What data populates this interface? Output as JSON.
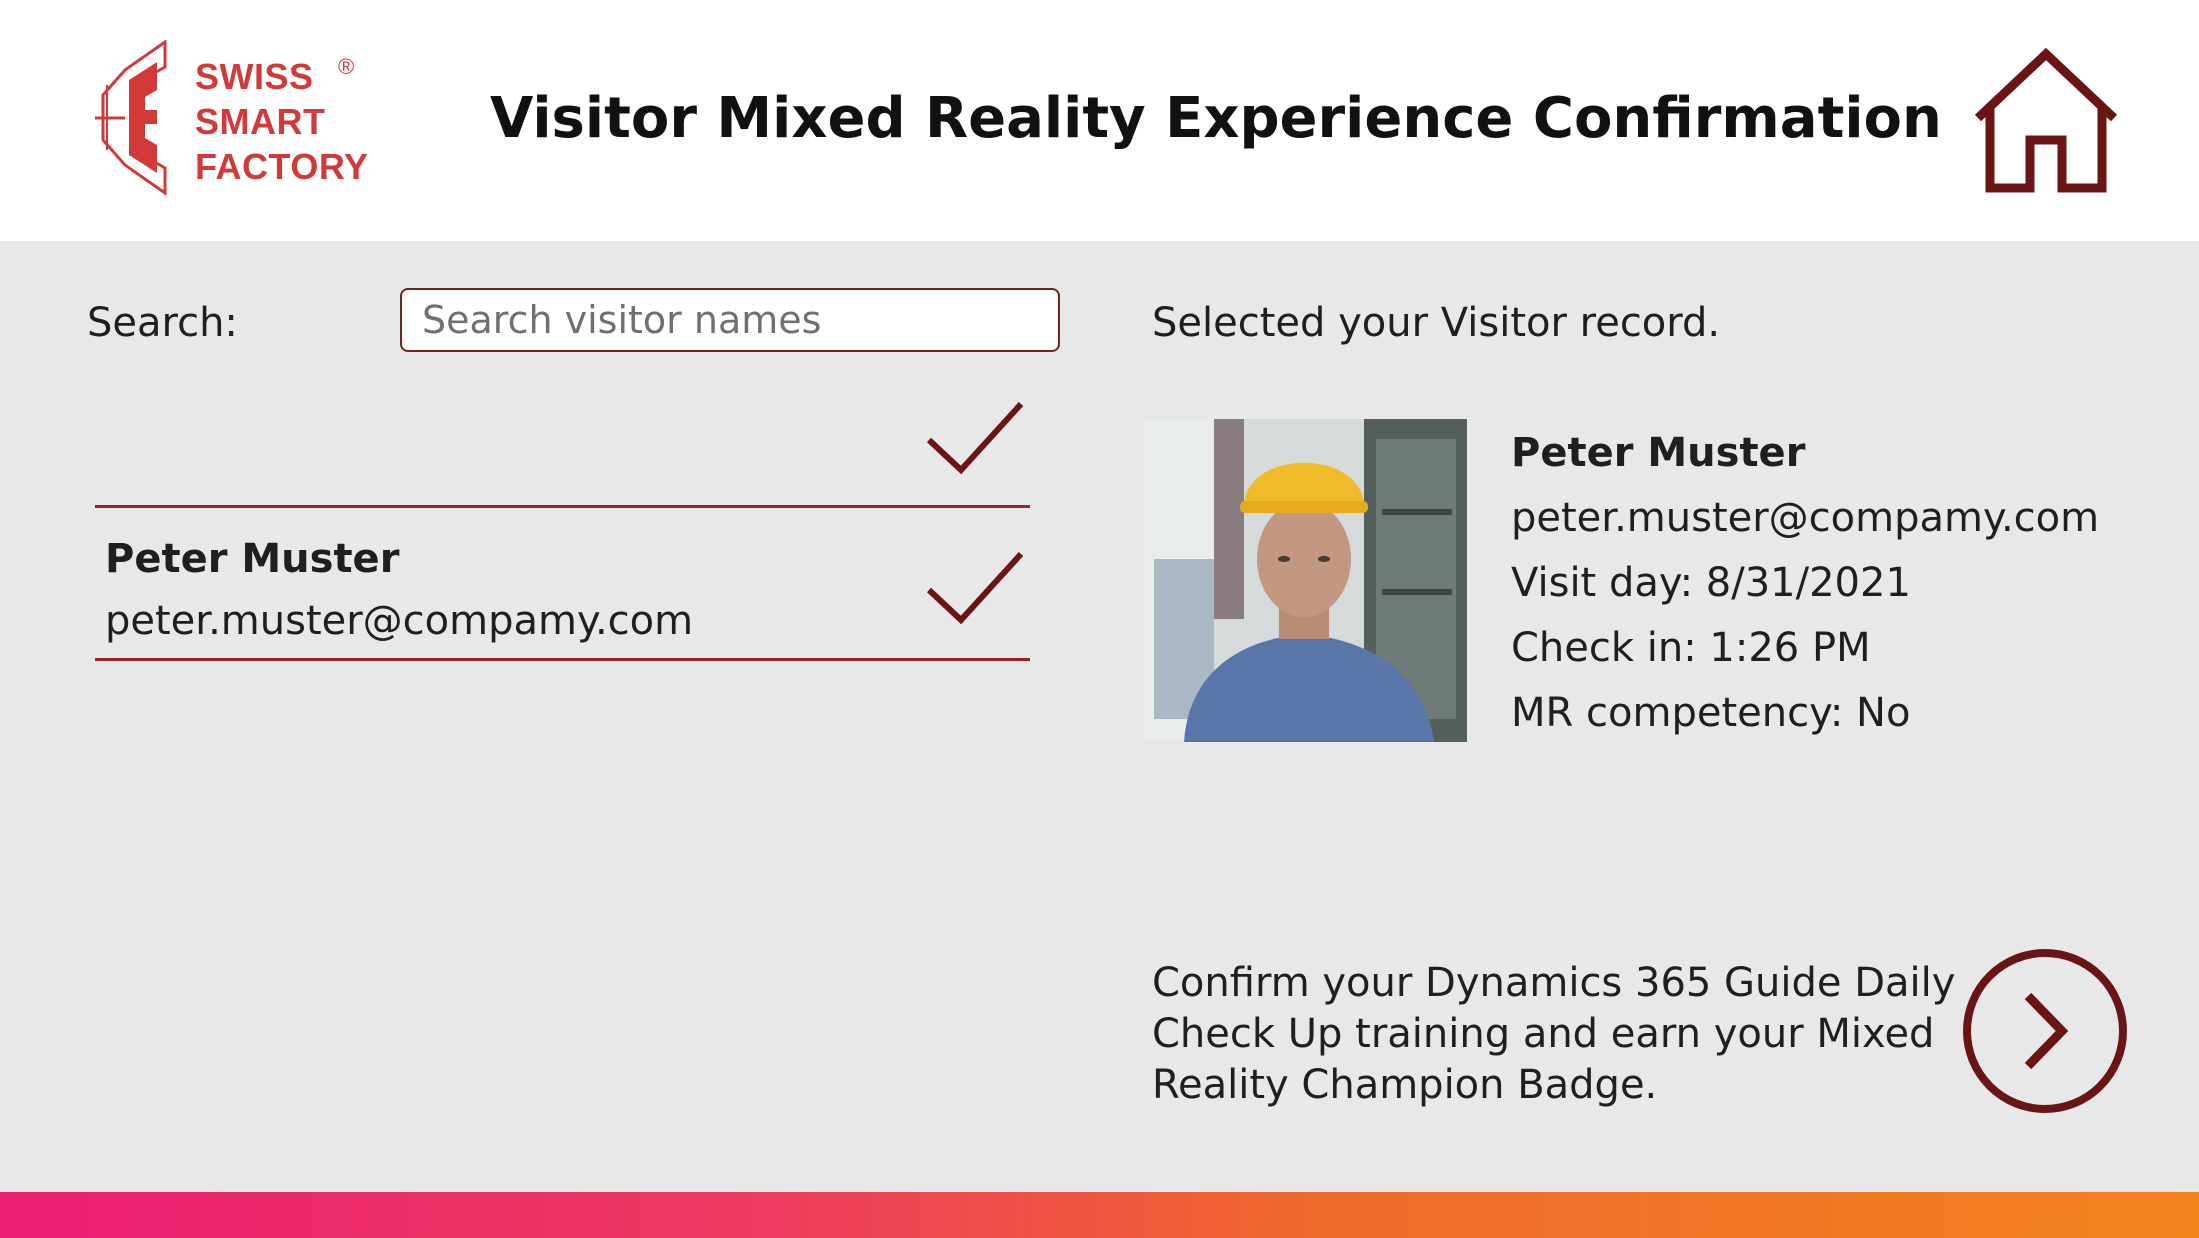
{
  "header": {
    "logo": {
      "line1": "SWISS",
      "line2": "SMART",
      "line3": "FACTORY",
      "reg": "®"
    },
    "title": "Visitor Mixed Reality Experience Confirmation"
  },
  "search": {
    "label": "Search:",
    "placeholder": "Search visitor names",
    "value": ""
  },
  "visitor_list": [
    {
      "name": "",
      "email": ""
    },
    {
      "name": "Peter Muster",
      "email": "peter.muster@compamy.com"
    }
  ],
  "selected": {
    "heading": "Selected your Visitor record.",
    "name": "Peter Muster",
    "email": "peter.muster@compamy.com",
    "visit_day": "Visit day: 8/31/2021",
    "check_in": "Check in: 1:26 PM",
    "mr_competency": "MR competency: No"
  },
  "confirm": {
    "text": "Confirm your Dynamics 365 Guide Daily Check Up training and earn your Mixed Reality Champion Badge."
  },
  "colors": {
    "accent": "#7a1e1e",
    "divider": "#9b2226",
    "logo": "#d23a3a",
    "background": "#e8e8e8",
    "gradient_start": "#e91e72",
    "gradient_end": "#f2841e"
  },
  "icons": {
    "home": "home-icon",
    "check": "checkmark-icon",
    "next": "chevron-right-circle-icon"
  }
}
